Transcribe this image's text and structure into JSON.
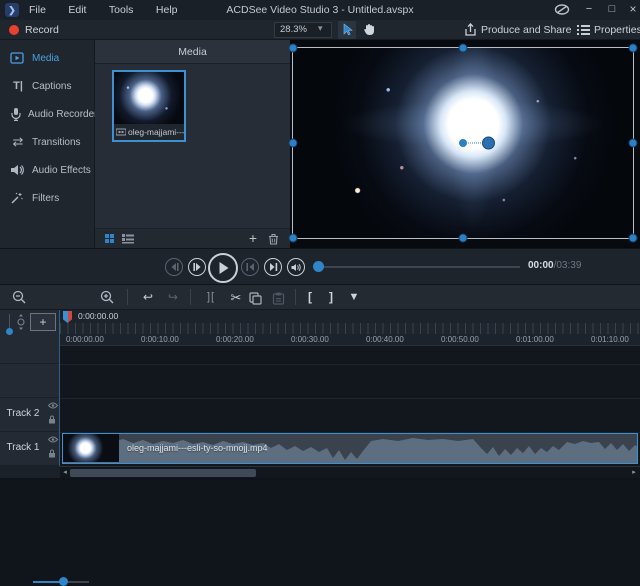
{
  "window": {
    "title": "ACDSee Video Studio 3 - Untitled.avspx",
    "menus": [
      "File",
      "Edit",
      "Tools",
      "Help"
    ],
    "app_icon_glyph": "❯"
  },
  "icons": {
    "minimize": "−",
    "maximize": "□",
    "close": "×",
    "chevron_down": "▾",
    "captions": "T|",
    "transitions": "⇄",
    "undo": "↩",
    "redo": "↪",
    "split": "][",
    "scissors": "✂",
    "mark_in": "[",
    "mark_out": "]",
    "marker": "▼",
    "plus": "+",
    "scroll_left": "◂",
    "scroll_right": "▸"
  },
  "toolbar": {
    "record_label": "Record",
    "zoom_value": "28.3%",
    "produce_share_label": "Produce and Share",
    "properties_label": "Properties"
  },
  "sidebar": {
    "items": [
      {
        "label": "Media",
        "active": true
      },
      {
        "label": "Captions"
      },
      {
        "label": "Audio Recorder"
      },
      {
        "label": "Transitions"
      },
      {
        "label": "Audio Effects"
      },
      {
        "label": "Filters"
      }
    ]
  },
  "media_panel": {
    "header": "Media",
    "item_caption": "oleg-majjami---..."
  },
  "transport": {
    "time_current": "00:00",
    "time_total": "/03:39"
  },
  "timeline": {
    "playhead_time": "0:00:00.00",
    "ruler_labels": [
      "0:00:00.00",
      "0:00:10.00",
      "0:00:20.00",
      "0:00:30.00",
      "0:00:40.00",
      "0:00:50.00",
      "0:01:00.00",
      "0:01:10.00"
    ],
    "track2_name": "Track 2",
    "track1_name": "Track 1",
    "clip_name": "oleg-majjami---esli-ty-so-mnojj.mp4"
  },
  "colors": {
    "accent_blue": "#2e86c9",
    "selection_blue": "#3f90d1",
    "record_red": "#e8412f",
    "clip_fill": "#5d6e80",
    "background_dark": "#1a2027"
  }
}
